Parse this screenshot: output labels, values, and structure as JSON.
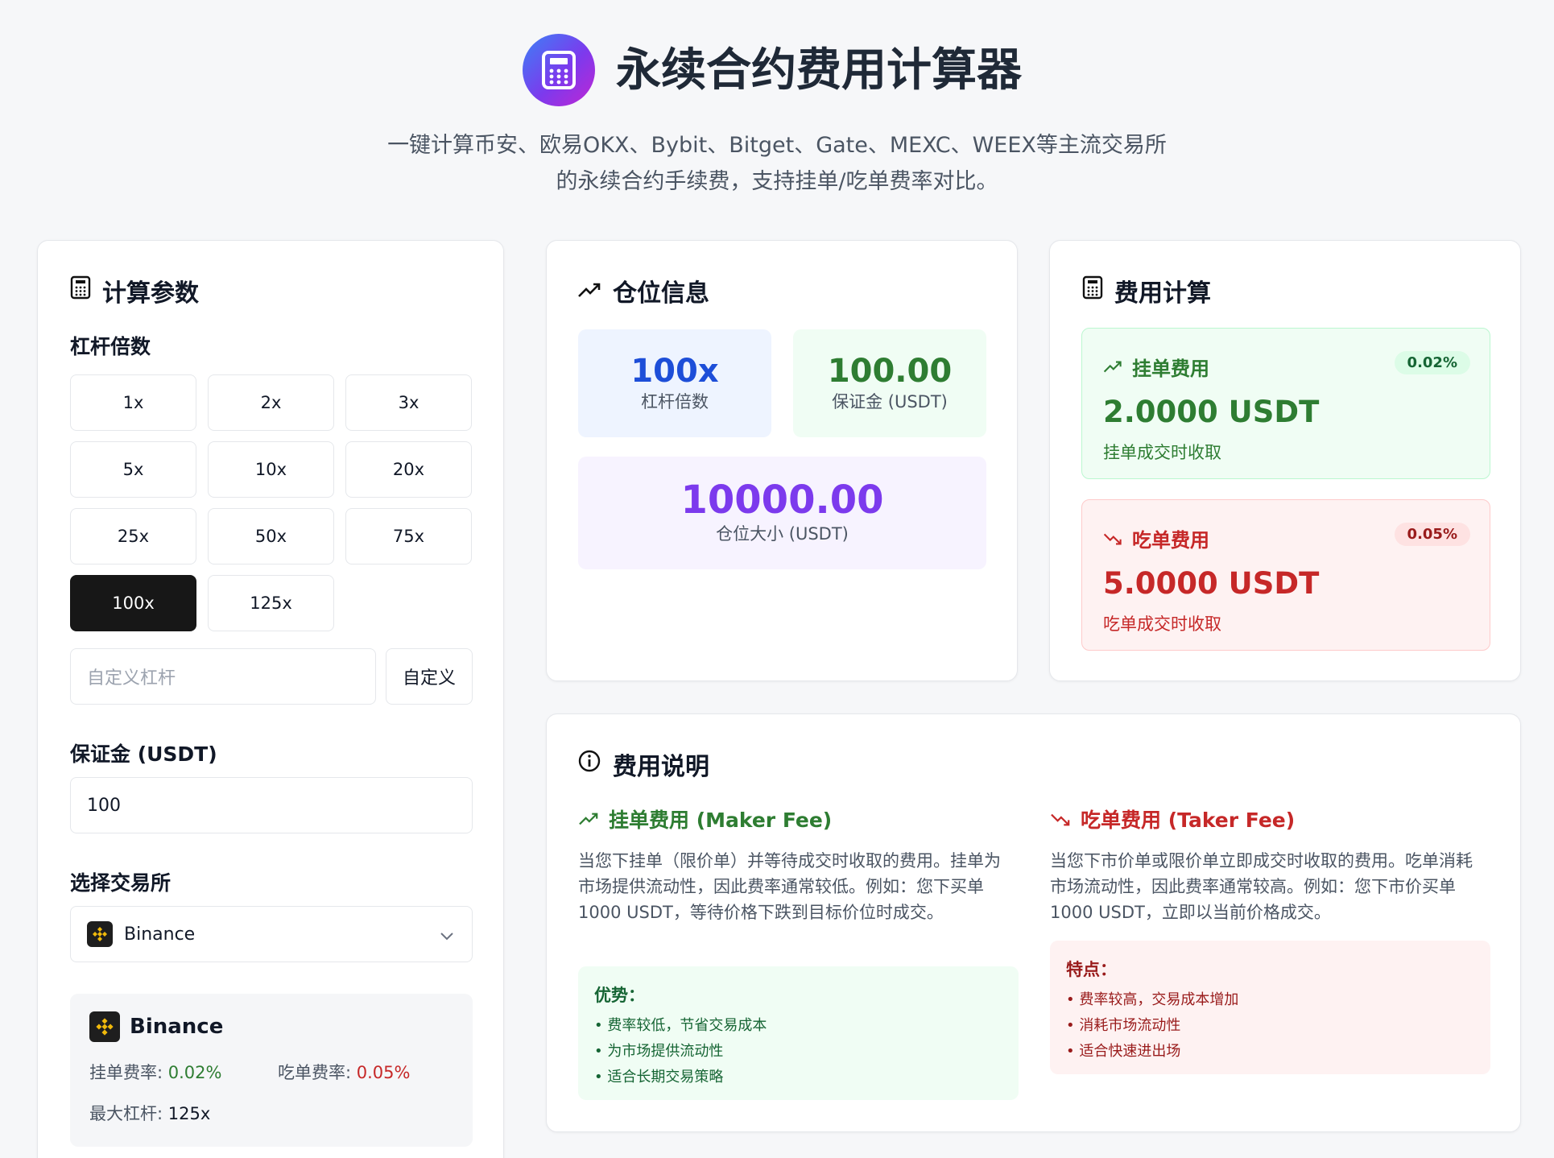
{
  "header": {
    "title": "永续合约费用计算器",
    "subtitle_line1": "一键计算币安、欧易OKX、Bybit、Bitget、Gate、MEXC、WEEX等主流交易所",
    "subtitle_line2": "的永续合约手续费，支持挂单/吃单费率对比。"
  },
  "params": {
    "title": "计算参数",
    "leverage_label": "杠杆倍数",
    "leverage_options": [
      "1x",
      "2x",
      "3x",
      "5x",
      "10x",
      "20x",
      "25x",
      "50x",
      "75x",
      "100x",
      "125x"
    ],
    "selected_leverage": "100x",
    "custom_placeholder": "自定义杠杆",
    "custom_button": "自定义",
    "margin_label": "保证金 (USDT)",
    "margin_value": "100",
    "exchange_label": "选择交易所",
    "exchange_selected": "Binance",
    "info": {
      "name": "Binance",
      "maker_label": "挂单费率: ",
      "maker_value": "0.02%",
      "taker_label": "吃单费率: ",
      "taker_value": "0.05%",
      "max_label": "最大杠杆: ",
      "max_value": "125x"
    }
  },
  "position": {
    "title": "仓位信息",
    "leverage_value": "100x",
    "leverage_caption": "杠杆倍数",
    "margin_value": "100.00",
    "margin_caption": "保证金 (USDT)",
    "size_value": "10000.00",
    "size_caption": "仓位大小 (USDT)"
  },
  "fees": {
    "title": "费用计算",
    "maker": {
      "label": "挂单费用",
      "rate": "0.02%",
      "value": "2.0000 USDT",
      "note": "挂单成交时收取"
    },
    "taker": {
      "label": "吃单费用",
      "rate": "0.05%",
      "value": "5.0000 USDT",
      "note": "吃单成交时收取"
    }
  },
  "explain": {
    "title": "费用说明",
    "maker": {
      "heading": "挂单费用 (Maker Fee)",
      "text": "当您下挂单（限价单）并等待成交时收取的费用。挂单为市场提供流动性，因此费率通常较低。例如：您下买单1000 USDT，等待价格下跌到目标价位时成交。",
      "box_title": "优势：",
      "items": [
        "费率较低，节省交易成本",
        "为市场提供流动性",
        "适合长期交易策略"
      ]
    },
    "taker": {
      "heading": "吃单费用 (Taker Fee)",
      "text": "当您下市价单或限价单立即成交时收取的费用。吃单消耗市场流动性，因此费率通常较高。例如：您下市价买单1000 USDT，立即以当前价格成交。",
      "box_title": "特点：",
      "items": [
        "费率较高，交易成本增加",
        "消耗市场流动性",
        "适合快速进出场"
      ]
    }
  },
  "colors": {
    "green": "#2e7d32",
    "red": "#c62828",
    "blue": "#1d4ed8",
    "purple": "#7c3aed"
  }
}
